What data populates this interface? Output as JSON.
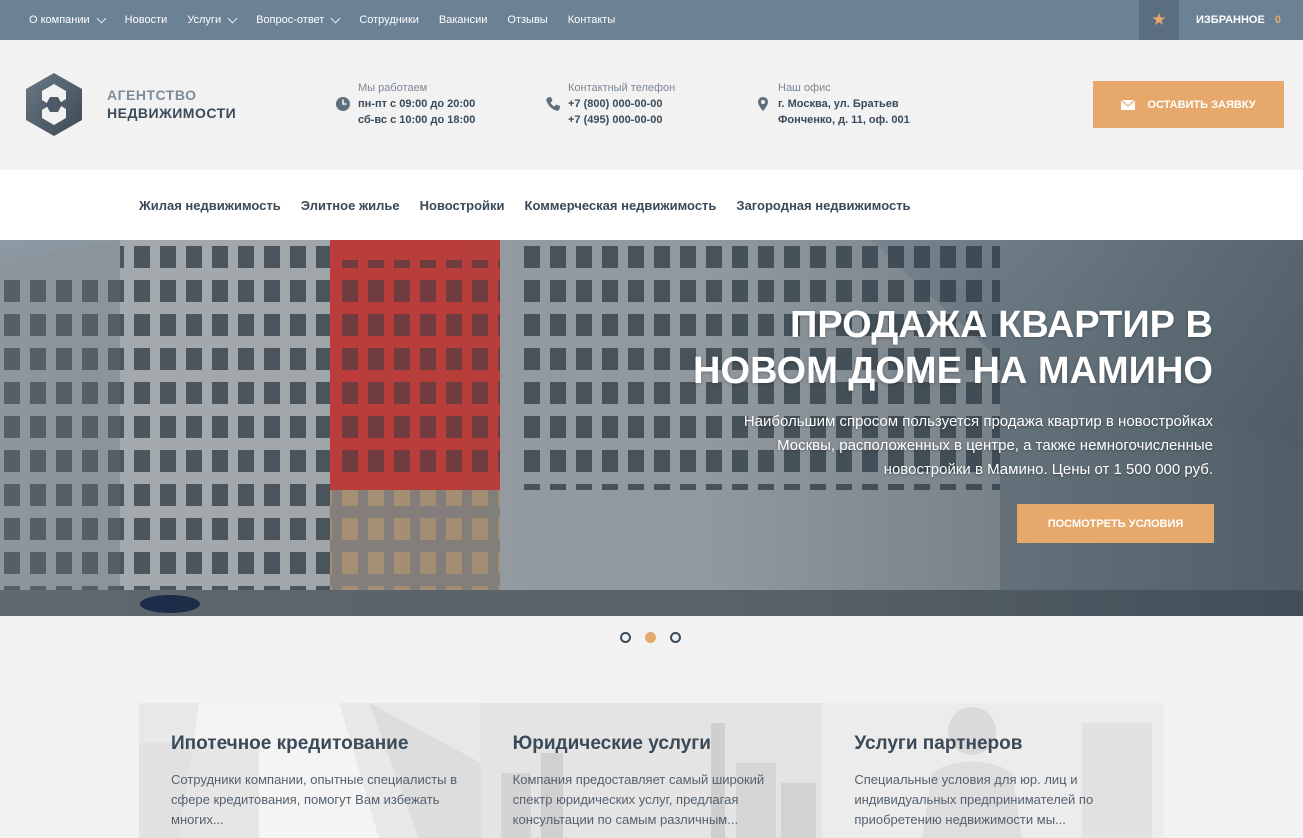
{
  "topbar": {
    "nav": [
      {
        "label": "О компании",
        "dropdown": true
      },
      {
        "label": "Новости",
        "dropdown": false
      },
      {
        "label": "Услуги",
        "dropdown": true
      },
      {
        "label": "Вопрос-ответ",
        "dropdown": true
      },
      {
        "label": "Сотрудники",
        "dropdown": false
      },
      {
        "label": "Вакансии",
        "dropdown": false
      },
      {
        "label": "Отзывы",
        "dropdown": false
      },
      {
        "label": "Контакты",
        "dropdown": false
      }
    ],
    "favorites_label": "ИЗБРАННОЕ",
    "favorites_count": "0",
    "star_icon": "star-icon"
  },
  "header": {
    "logo_line1": "АГЕНТСТВО",
    "logo_line2": "НЕДВИЖИМОСТИ",
    "hours": {
      "label": "Мы работаем",
      "line1": "пн-пт с 09:00 до 20:00",
      "line2": "сб-вс с 10:00 до 18:00",
      "icon": "clock-icon"
    },
    "phone": {
      "label": "Контактный телефон",
      "line1": "+7 (800) 000-00-00",
      "line2": "+7 (495) 000-00-00",
      "icon": "phone-icon"
    },
    "office": {
      "label": "Наш офис",
      "line1": "г. Москва, ул. Братьев",
      "line2": "Фонченко, д. 11, оф. 001",
      "icon": "map-pin-icon"
    },
    "cta_label": "ОСТАВИТЬ ЗАЯВКУ",
    "cta_icon": "envelope-icon"
  },
  "mainnav": [
    "Жилая недвижимость",
    "Элитное жилье",
    "Новостройки",
    "Коммерческая недвижимость",
    "Загородная недвижимость"
  ],
  "hero": {
    "title_line1": "ПРОДАЖА КВАРТИР В",
    "title_line2": "НОВОМ ДОМЕ НА МАМИНО",
    "subtitle": "Наибольшим спросом пользуется продажа квартир в новостройках Москвы, расположенных в центре, а также немногочисленные новостройки в Мамино. Цены от 1 500 000 руб.",
    "button": "ПОСМОТРЕТЬ УСЛОВИЯ",
    "slides": 3,
    "active_slide": 2
  },
  "cards": [
    {
      "title": "Ипотечное кредитование",
      "text": "Сотрудники компании, опытные специалисты в сфере кредитования, помогут Вам избежать многих..."
    },
    {
      "title": "Юридические услуги",
      "text": "Компания предоставляет самый широкий спектр юридических услуг, предлагая консультации по самым различным..."
    },
    {
      "title": "Услуги партнеров",
      "text": "Специальные условия для юр. лиц и индивидуальных предпринимателей по приобретению недвижимости мы..."
    }
  ],
  "colors": {
    "topbar": "#6b8194",
    "accent": "#e6a96b",
    "text_dark": "#3a4a58"
  }
}
